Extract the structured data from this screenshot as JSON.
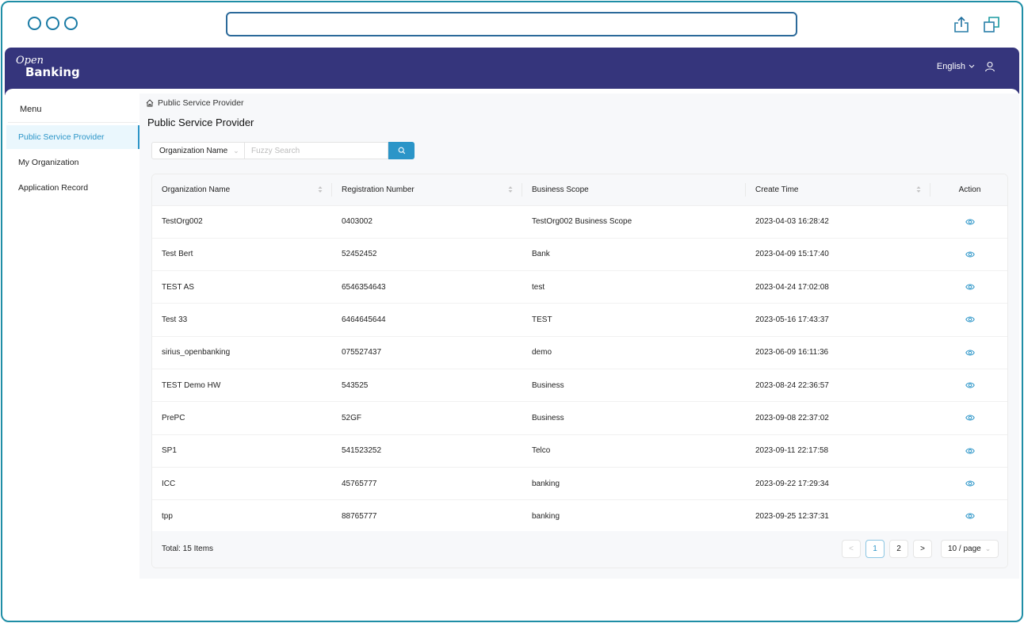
{
  "browser": {
    "address_value": "",
    "icons": [
      "share-icon",
      "duplicate-window-icon"
    ]
  },
  "header": {
    "logo_top": "Open",
    "logo_bottom": "Banking",
    "language": "English",
    "colors": {
      "header_bg": "#35357c",
      "accent": "#2b95c8"
    }
  },
  "sidebar": {
    "title": "Menu",
    "items": [
      {
        "label": "Public Service Provider",
        "active": true
      },
      {
        "label": "My Organization",
        "active": false
      },
      {
        "label": "Application Record",
        "active": false
      }
    ]
  },
  "main": {
    "breadcrumb": "Public Service Provider",
    "title": "Public Service Provider",
    "search": {
      "field_select": "Organization Name",
      "value": "",
      "placeholder": "Fuzzy Search"
    },
    "table": {
      "columns": [
        "Organization Name",
        "Registration Number",
        "Business Scope",
        "Create Time",
        "Action"
      ],
      "rows": [
        [
          "TestOrg002",
          "0403002",
          "TestOrg002 Business Scope",
          "2023-04-03 16:28:42"
        ],
        [
          "Test Bert",
          "52452452",
          "Bank",
          "2023-04-09 15:17:40"
        ],
        [
          "TEST AS",
          "6546354643",
          "test",
          "2023-04-24 17:02:08"
        ],
        [
          "Test 33",
          "6464645644",
          "TEST",
          "2023-05-16 17:43:37"
        ],
        [
          "sirius_openbanking",
          "075527437",
          "demo",
          "2023-06-09 16:11:36"
        ],
        [
          "TEST Demo HW",
          "543525",
          "Business",
          "2023-08-24 22:36:57"
        ],
        [
          "PrePC",
          "52GF",
          "Business",
          "2023-09-08 22:37:02"
        ],
        [
          "SP1",
          "541523252",
          "Telco",
          "2023-09-11 22:17:58"
        ],
        [
          "ICC",
          "45765777",
          "banking",
          "2023-09-22 17:29:34"
        ],
        [
          "tpp",
          "88765777",
          "banking",
          "2023-09-25 12:37:31"
        ]
      ]
    },
    "footer": {
      "total": "Total: 15 Items",
      "pages": [
        "1",
        "2"
      ],
      "current_page": "1",
      "prev": "<",
      "next": ">",
      "page_size": "10 / page"
    }
  }
}
